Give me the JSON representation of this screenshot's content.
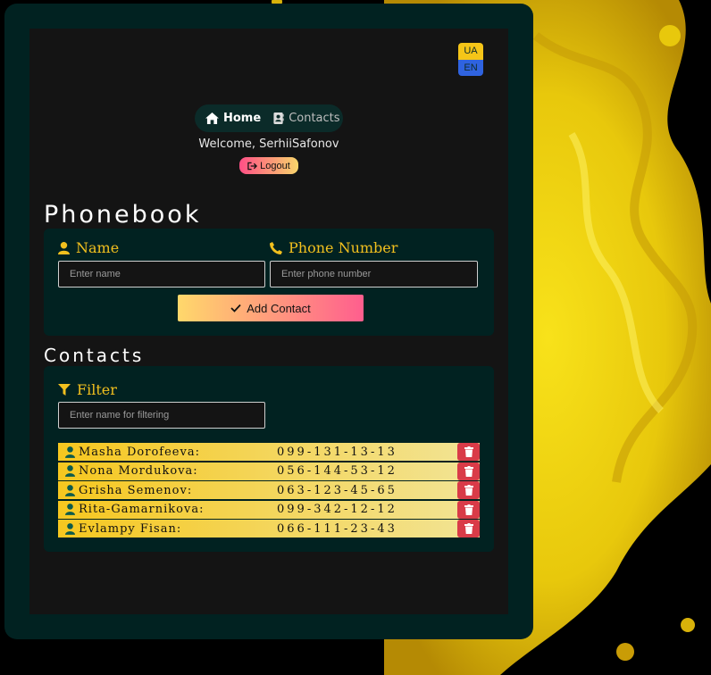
{
  "lang": {
    "ua": "UA",
    "en": "EN"
  },
  "nav": {
    "home": "Home",
    "contacts": "Contacts"
  },
  "welcome": "Welcome, SerhiiSafonov",
  "logout": "Logout",
  "phonebook_title": "Phonebook",
  "form": {
    "name_label": "Name",
    "name_placeholder": "Enter name",
    "phone_label": "Phone Number",
    "phone_placeholder": "Enter phone number",
    "add_button": "Add Contact"
  },
  "contacts_title": "Contacts",
  "filter": {
    "label": "Filter",
    "placeholder": "Enter name for filtering"
  },
  "contacts": [
    {
      "name": "Masha Dorofeeva:",
      "phone": "099-131-13-13"
    },
    {
      "name": "Nona Mordukova:",
      "phone": "056-144-53-12"
    },
    {
      "name": "Grisha Semenov:",
      "phone": "063-123-45-65"
    },
    {
      "name": "Rita-Gamarnikova:",
      "phone": "099-342-12-12"
    },
    {
      "name": "Evlampy Fisan:",
      "phone": "066-111-23-43"
    }
  ],
  "colors": {
    "accent": "#f2c01e",
    "card": "#012221",
    "panel": "#141414",
    "delete": "#d93b48"
  }
}
